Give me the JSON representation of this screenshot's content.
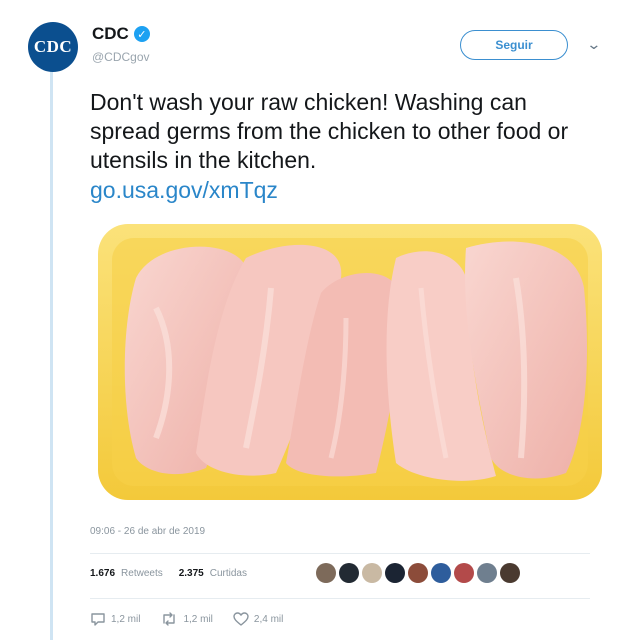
{
  "tweet": {
    "author": {
      "avatar_text": "CDC",
      "display_name": "CDC",
      "handle": "@CDCgov",
      "verified": true
    },
    "follow_label": "Seguir",
    "text": "Don't wash your raw chicken! Washing can spread germs from the chicken to other food or utensils in the kitchen.",
    "link": "go.usa.gov/xmTqz",
    "timestamp": "09:06 - 26 de abr de 2019",
    "stats": {
      "retweets_count": "1.676",
      "retweets_label": "Retweets",
      "likes_count": "2.375",
      "likes_label": "Curtidas"
    },
    "liker_avatar_colors": [
      "#7d6a5a",
      "#222a33",
      "#c9b9a3",
      "#1b2433",
      "#8c4c3a",
      "#2e5d9c",
      "#b34a4a",
      "#6f7f8f",
      "#4a3a30"
    ],
    "actions": {
      "reply_count": "1,2 mil",
      "retweet_count": "1,2 mil",
      "like_count": "2,4 mil"
    }
  },
  "colors": {
    "accent": "#1da1f2",
    "link": "#2a86c9",
    "tray": "#f7d54a",
    "chicken": "#f4c2bd"
  }
}
